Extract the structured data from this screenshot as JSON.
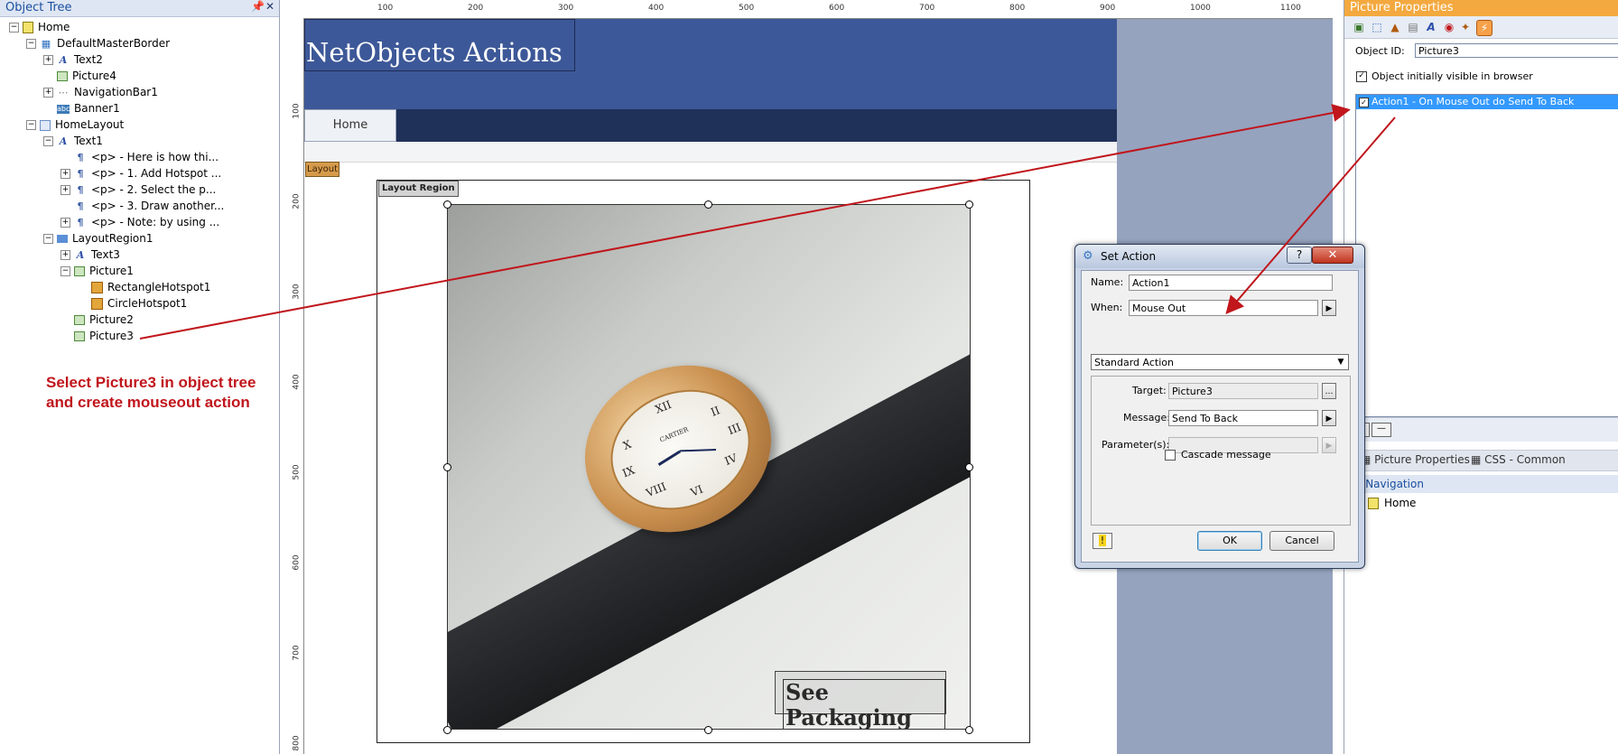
{
  "object_tree": {
    "title": "Object Tree",
    "items": [
      {
        "label": "Home",
        "expander": "-",
        "icon": "page-icon"
      },
      {
        "label": "DefaultMasterBorder",
        "expander": "-",
        "icon": "master-border-icon"
      },
      {
        "label": "Text2",
        "expander": "+",
        "icon": "text-icon"
      },
      {
        "label": "Picture4",
        "expander": "",
        "icon": "picture-icon"
      },
      {
        "label": "NavigationBar1",
        "expander": "+",
        "icon": "navigation-bar-icon"
      },
      {
        "label": "Banner1",
        "expander": "",
        "icon": "banner-icon"
      },
      {
        "label": "HomeLayout",
        "expander": "-",
        "icon": "layout-icon"
      },
      {
        "label": "Text1",
        "expander": "-",
        "icon": "text-icon"
      },
      {
        "label": "<p> - Here is how thi...",
        "expander": "",
        "icon": "paragraph-icon"
      },
      {
        "label": "<p> - 1. Add Hotspot ...",
        "expander": "+",
        "icon": "paragraph-icon"
      },
      {
        "label": "<p> - 2. Select the p...",
        "expander": "+",
        "icon": "paragraph-icon"
      },
      {
        "label": "<p> - 3. Draw another...",
        "expander": "",
        "icon": "paragraph-icon"
      },
      {
        "label": "<p> - Note: by using ...",
        "expander": "+",
        "icon": "paragraph-icon"
      },
      {
        "label": "LayoutRegion1",
        "expander": "-",
        "icon": "layout-region-icon"
      },
      {
        "label": "Text3",
        "expander": "+",
        "icon": "text-icon"
      },
      {
        "label": "Picture1",
        "expander": "-",
        "icon": "picture-icon"
      },
      {
        "label": "RectangleHotspot1",
        "expander": "",
        "icon": "rectangle-hotspot-icon"
      },
      {
        "label": "CircleHotspot1",
        "expander": "",
        "icon": "circle-hotspot-icon"
      },
      {
        "label": "Picture2",
        "expander": "",
        "icon": "picture-icon"
      },
      {
        "label": "Picture3",
        "expander": "",
        "icon": "picture-icon"
      }
    ]
  },
  "annotation": "Select Picture3 in object tree and create mouseout action",
  "ruler": {
    "top_ticks": [
      "100",
      "200",
      "300",
      "400",
      "500",
      "600",
      "700",
      "800",
      "900",
      "1000",
      "1100"
    ],
    "left_ticks": [
      "100",
      "200",
      "300",
      "400",
      "500",
      "600",
      "700",
      "800"
    ]
  },
  "canvas": {
    "banner_title": "NetObjects Actions",
    "nav_home": "Home",
    "layout_tag": "Layout",
    "layout_region_label": "Layout Region",
    "see_packaging": "See Packaging",
    "watch_brand": "CARTIER"
  },
  "properties": {
    "title": "Picture Properties",
    "object_id_label": "Object ID:",
    "object_id_value": "Picture3",
    "visible_label": "Object initially visible in browser",
    "visible_checked": true,
    "action_item": "Action1 - On Mouse Out do Send To Back",
    "tabs": [
      "Picture Properties",
      "CSS - Common"
    ],
    "site_nav_header": "e Navigation",
    "site_nav_home": "Home"
  },
  "dialog": {
    "title": "Set Action",
    "help": "?",
    "close": "✕",
    "name_label": "Name:",
    "name_value": "Action1",
    "when_label": "When:",
    "when_value": "Mouse Out",
    "action_type": "Standard Action",
    "target_label": "Target:",
    "target_value": "Picture3",
    "message_label": "Message:",
    "message_value": "Send To Back",
    "parameters_label": "Parameter(s):",
    "parameters_value": "",
    "cascade_label": "Cascade message",
    "ok": "OK",
    "cancel": "Cancel"
  },
  "colors": {
    "banner": "#3d5898",
    "navbar": "#1f3159",
    "props_header": "#f3a93f",
    "annotation": "#c0161c",
    "selection": "#3399ff"
  }
}
